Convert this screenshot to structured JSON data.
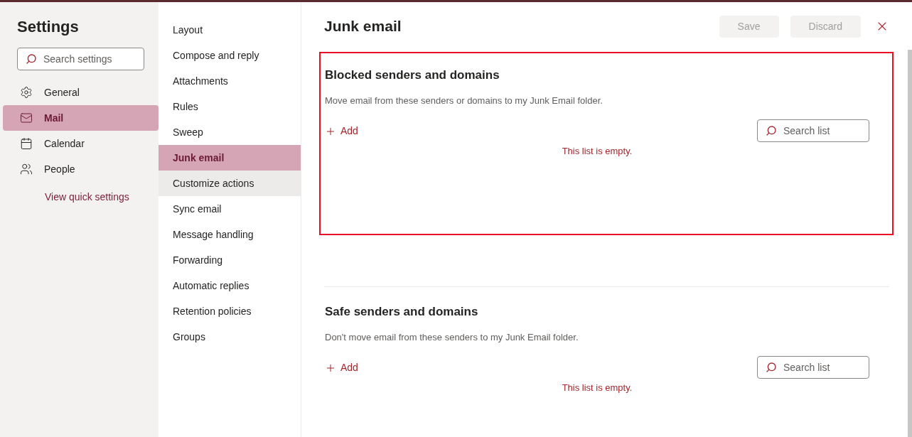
{
  "settings": {
    "title": "Settings",
    "search": {
      "placeholder": "Search settings"
    },
    "categories": [
      {
        "kind": "general",
        "label": "General",
        "selected": false
      },
      {
        "kind": "mail",
        "label": "Mail",
        "selected": true
      },
      {
        "kind": "calendar",
        "label": "Calendar",
        "selected": false
      },
      {
        "kind": "people",
        "label": "People",
        "selected": false
      }
    ],
    "quick_link": "View quick settings"
  },
  "subnav": [
    {
      "label": "Layout",
      "selected": false,
      "hovered": false
    },
    {
      "label": "Compose and reply",
      "selected": false,
      "hovered": false
    },
    {
      "label": "Attachments",
      "selected": false,
      "hovered": false
    },
    {
      "label": "Rules",
      "selected": false,
      "hovered": false
    },
    {
      "label": "Sweep",
      "selected": false,
      "hovered": false
    },
    {
      "label": "Junk email",
      "selected": true,
      "hovered": false
    },
    {
      "label": "Customize actions",
      "selected": false,
      "hovered": true
    },
    {
      "label": "Sync email",
      "selected": false,
      "hovered": false
    },
    {
      "label": "Message handling",
      "selected": false,
      "hovered": false
    },
    {
      "label": "Forwarding",
      "selected": false,
      "hovered": false
    },
    {
      "label": "Automatic replies",
      "selected": false,
      "hovered": false
    },
    {
      "label": "Retention policies",
      "selected": false,
      "hovered": false
    },
    {
      "label": "Groups",
      "selected": false,
      "hovered": false
    }
  ],
  "panel": {
    "title": "Junk email",
    "buttons": [
      {
        "label": "Save",
        "disabled": true
      },
      {
        "label": "Discard",
        "disabled": true
      }
    ],
    "sections": [
      {
        "title": "Blocked senders and domains",
        "description": "Move email from these senders or domains to my Junk Email folder.",
        "add": "Add",
        "search": {
          "placeholder": "Search list"
        },
        "empty": "This list is empty.",
        "highlighted": true
      },
      {
        "title": "Safe senders and domains",
        "description": "Don't move email from these senders to my Junk Email folder.",
        "add": "Add",
        "search": {
          "placeholder": "Search list"
        },
        "empty": "This list is empty.",
        "highlighted": false
      }
    ]
  }
}
